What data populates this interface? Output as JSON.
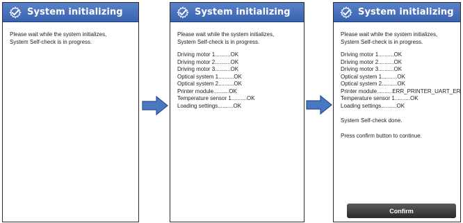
{
  "colors": {
    "title_bar": "#3a63b0",
    "arrow": "#4a78c0",
    "confirm_button": "#3a3a3a"
  },
  "screens": [
    {
      "title": "System initializing",
      "icon": "gear-check-icon",
      "intro_line1": "Please wait while the system initializes,",
      "intro_line2": "System Self-check is in progress."
    },
    {
      "title": "System initializing",
      "icon": "gear-check-icon",
      "intro_line1": "Please wait while the system initializes,",
      "intro_line2": "System Self-check is in progress.",
      "checks": [
        "Driving motor 1..........OK",
        "Driving motor 2..........OK",
        "Driving motor 3..........OK",
        "Optical system 1..........OK",
        "Optical system 2..........OK",
        "Printer module..........OK",
        "Temperature sensor 1..........OK",
        "Loading settings..........OK"
      ]
    },
    {
      "title": "System initializing",
      "icon": "gear-check-icon",
      "intro_line1": "Please wait while the system initializes,",
      "intro_line2": "System Self-check is in progress.",
      "checks": [
        "Driving motor 1..........OK",
        "Driving motor 2..........OK",
        "Driving motor 3..........OK",
        "Optical system 1..........OK",
        "Optical system 2..........OK",
        "Printer module..........ERR_PRINTER_UART_ERROR",
        "Temperature sensor 1..........OK",
        "Loading settings..........OK"
      ],
      "done_message": "System Self-check done.",
      "prompt_message": "Press confirm button to continue.",
      "confirm_label": "Confirm"
    }
  ],
  "arrows": [
    "right-arrow-icon",
    "right-arrow-icon"
  ]
}
